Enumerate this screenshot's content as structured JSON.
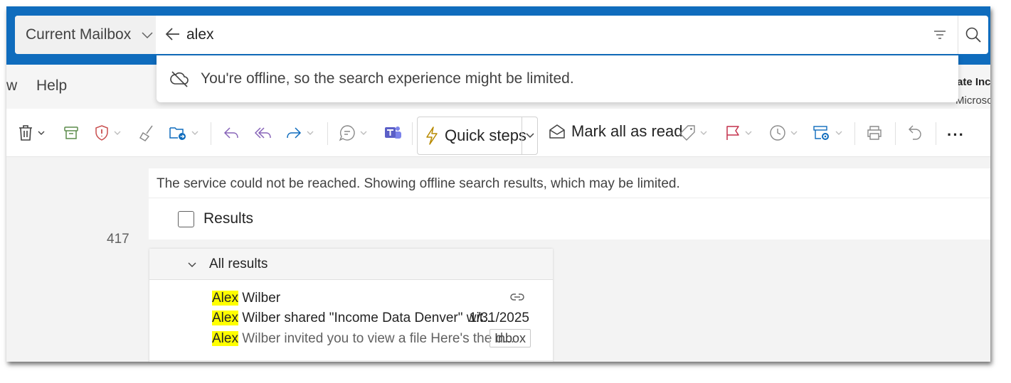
{
  "search": {
    "scope_label": "Current Mailbox",
    "query": "alex"
  },
  "offline_banner": "You're offline, so the search experience might be limited.",
  "ribbon": {
    "tab_partial": "w",
    "tab_help": "Help"
  },
  "account": {
    "line1": "ate Inc",
    "line2": "Microso"
  },
  "toolbar": {
    "quick_steps_label": "Quick steps",
    "mark_all_read_label": "Mark all as read",
    "more_label": "···"
  },
  "colors": {
    "header_blue": "#0f6cbd",
    "highlight": "#ffff00",
    "bolt": "#b88a00",
    "archive_green": "#5c8c4b",
    "report_red": "#c94f4f",
    "reply_purple": "#8764b8",
    "flag_red": "#c4314b",
    "teams_purple": "#5b5fc7",
    "blue_icon": "#0f6cbd"
  },
  "mail": {
    "count": "417",
    "service_notice": "The service could not be reached. Showing offline search results, which may be limited.",
    "results_label": "Results",
    "group_label": "All results",
    "items": [
      {
        "sender_hl": "Alex",
        "sender_rest": " Wilber",
        "subject_hl": "Alex",
        "subject_rest": " Wilber shared \"Income Data Denver\" wit...",
        "date": "1/31/2025",
        "preview_hl": "Alex",
        "preview_rest": " Wilber invited you to view a file Here's the d...",
        "folder": "Inbox"
      }
    ]
  }
}
